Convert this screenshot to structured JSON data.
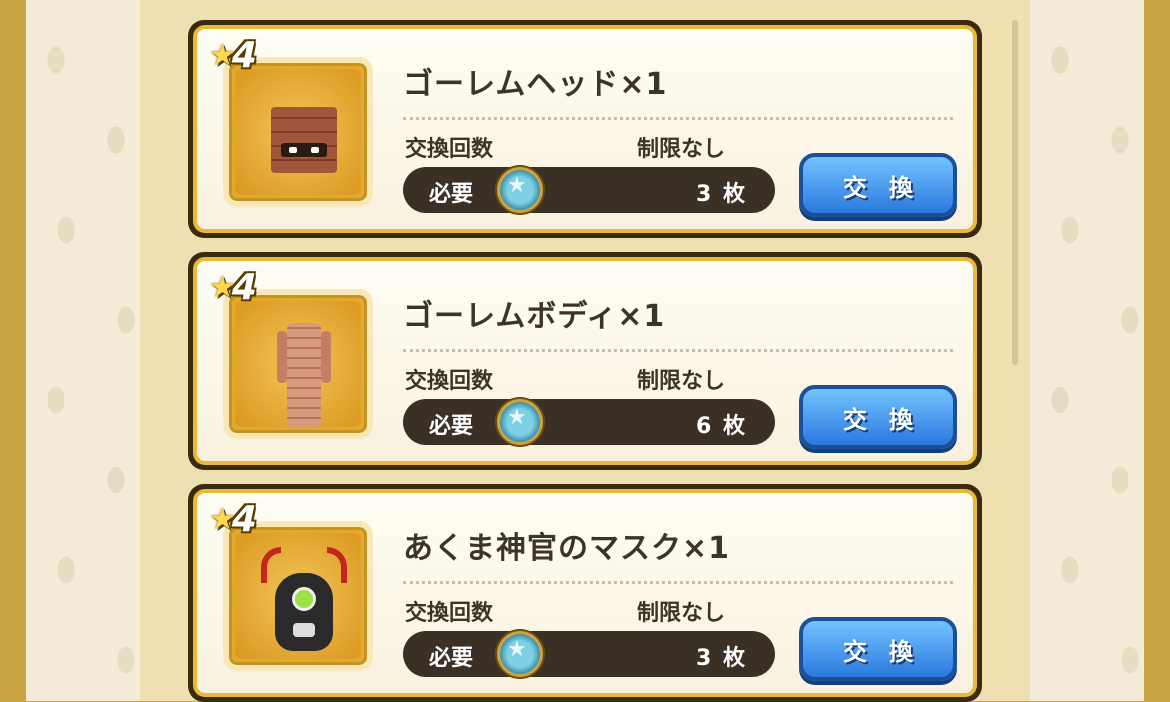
{
  "items": [
    {
      "rarity": "4",
      "name": "ゴーレムヘッド×1",
      "count_label": "交換回数",
      "limit": "制限なし",
      "need_label": "必要",
      "need_value": "3 枚",
      "button": "交換",
      "icon": "golem-head"
    },
    {
      "rarity": "4",
      "name": "ゴーレムボディ×1",
      "count_label": "交換回数",
      "limit": "制限なし",
      "need_label": "必要",
      "need_value": "6 枚",
      "button": "交換",
      "icon": "golem-body"
    },
    {
      "rarity": "4",
      "name": "あくま神官のマスク×1",
      "count_label": "交換回数",
      "limit": "制限なし",
      "need_label": "必要",
      "need_value": "3 枚",
      "button": "交換",
      "icon": "demon-priest-mask"
    }
  ],
  "currency_icon": "medal-icon",
  "colors": {
    "button": "#2b78df",
    "frame": "#e9b93a",
    "need_bar": "#3b3026"
  }
}
